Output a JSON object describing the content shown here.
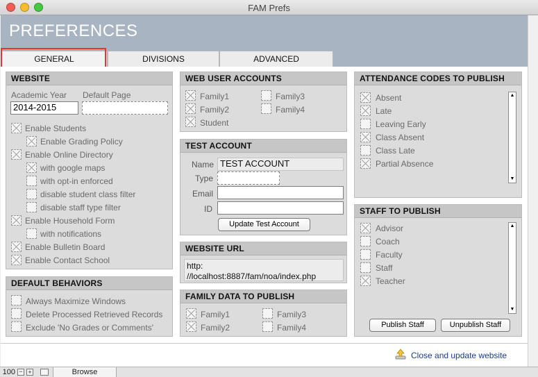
{
  "window": {
    "title": "FAM Prefs"
  },
  "page": {
    "title": "PREFERENCES"
  },
  "tabs": [
    "GENERAL",
    "DIVISIONS",
    "ADVANCED"
  ],
  "website": {
    "header": "WEBSITE",
    "academic_year_label": "Academic Year",
    "academic_year_value": "2014-2015",
    "default_page_label": "Default Page",
    "default_page_value": "",
    "options": [
      {
        "label": "Enable Students",
        "checked": true
      },
      {
        "label": "Enable Grading Policy",
        "checked": true
      },
      {
        "label": "Enable Online Directory",
        "checked": true
      },
      {
        "label": "with google maps",
        "checked": true
      },
      {
        "label": "with opt-in enforced",
        "checked": false
      },
      {
        "label": "disable student class filter",
        "checked": false
      },
      {
        "label": "disable staff type filter",
        "checked": false
      },
      {
        "label": "Enable Household Form",
        "checked": true
      },
      {
        "label": "with notifications",
        "checked": false
      },
      {
        "label": "Enable Bulletin Board",
        "checked": true
      },
      {
        "label": "Enable Contact School",
        "checked": true
      }
    ]
  },
  "default_behaviors": {
    "header": "DEFAULT BEHAVIORS",
    "options": [
      {
        "label": "Always Maximize Windows",
        "checked": false
      },
      {
        "label": "Delete Processed Retrieved Records",
        "checked": false
      },
      {
        "label": "Exclude 'No Grades or Comments'",
        "checked": false
      }
    ]
  },
  "web_user_accounts": {
    "header": "WEB USER ACCOUNTS",
    "options": [
      {
        "label": "Family1",
        "checked": true
      },
      {
        "label": "Family3",
        "checked": false
      },
      {
        "label": "Family2",
        "checked": true
      },
      {
        "label": "Family4",
        "checked": false
      },
      {
        "label": "Student",
        "checked": true
      }
    ]
  },
  "test_account": {
    "header": "TEST ACCOUNT",
    "name_label": "Name",
    "name_value": "TEST ACCOUNT",
    "type_label": "Type",
    "type_value": "",
    "email_label": "Email",
    "email_value": "",
    "id_label": "ID",
    "id_value": "",
    "button": "Update Test Account"
  },
  "website_url": {
    "header": "WEBSITE URL",
    "line1": "http:",
    "line2": "//localhost:8887/fam/noa/index.php"
  },
  "family_data": {
    "header": "FAMILY DATA TO PUBLISH",
    "options": [
      {
        "label": "Family1",
        "checked": true
      },
      {
        "label": "Family3",
        "checked": false
      },
      {
        "label": "Family2",
        "checked": true
      },
      {
        "label": "Family4",
        "checked": false
      }
    ]
  },
  "attendance_codes": {
    "header": "ATTENDANCE CODES TO PUBLISH",
    "options": [
      {
        "label": "Absent",
        "checked": true
      },
      {
        "label": "Late",
        "checked": true
      },
      {
        "label": "Leaving Early",
        "checked": false
      },
      {
        "label": "Class Absent",
        "checked": true
      },
      {
        "label": "Class Late",
        "checked": false
      },
      {
        "label": "Partial Absence",
        "checked": true
      }
    ]
  },
  "staff_to_publish": {
    "header": "STAFF TO PUBLISH",
    "options": [
      {
        "label": "Advisor",
        "checked": true
      },
      {
        "label": "Coach",
        "checked": false
      },
      {
        "label": "Faculty",
        "checked": false
      },
      {
        "label": "Staff",
        "checked": false
      },
      {
        "label": "Teacher",
        "checked": true
      }
    ],
    "publish_button": "Publish Staff",
    "unpublish_button": "Unpublish Staff"
  },
  "footer": {
    "close_update": "Close and update website"
  },
  "statusbar": {
    "zoom": "100",
    "mode": "Browse"
  }
}
